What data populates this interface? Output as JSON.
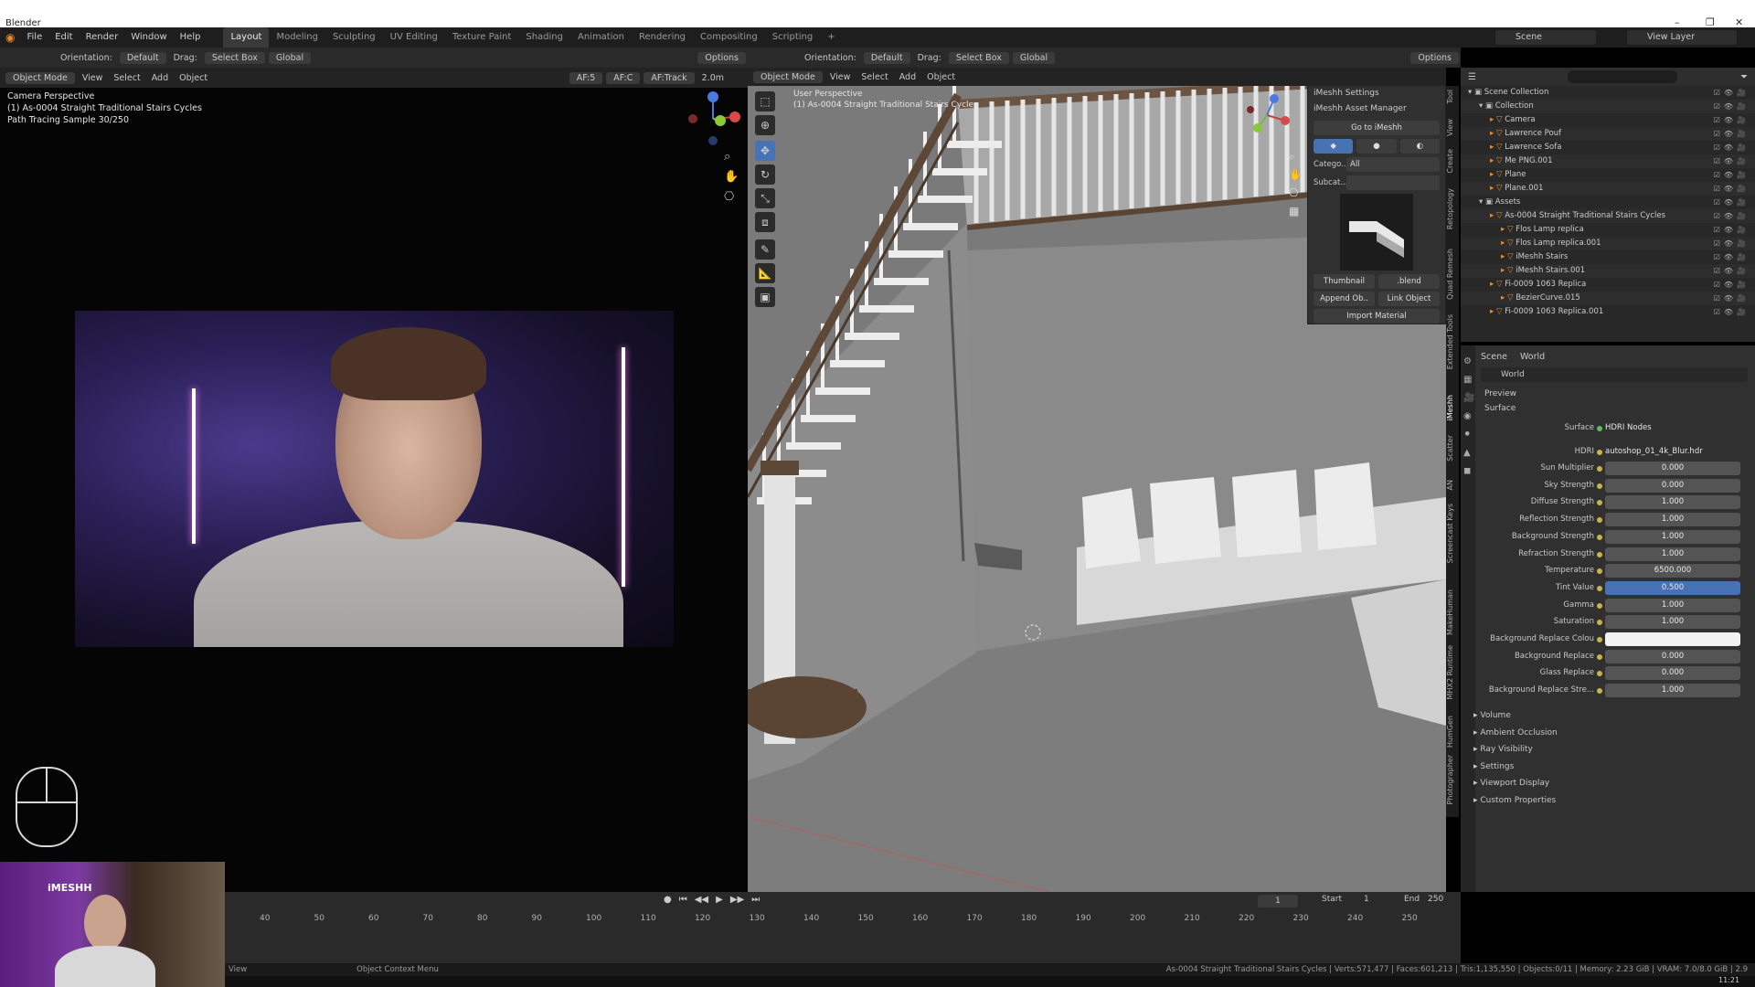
{
  "window": {
    "title": "Blender"
  },
  "menu": [
    "File",
    "Edit",
    "Render",
    "Window",
    "Help"
  ],
  "workspaces": [
    "Layout",
    "Modeling",
    "Sculpting",
    "UV Editing",
    "Texture Paint",
    "Shading",
    "Animation",
    "Rendering",
    "Compositing",
    "Scripting",
    "+"
  ],
  "active_workspace": "Layout",
  "scene_field": "Scene",
  "view_layer_field": "View Layer",
  "left_header": {
    "orientation_label": "Orientation:",
    "orientation_value": "Default",
    "drag_label": "Drag:",
    "drag_value": "Select Box",
    "transform": "Global",
    "options": "Options",
    "mode": "Object Mode",
    "view": "View",
    "select": "Select",
    "add": "Add",
    "object": "Object",
    "af5": "AF:5",
    "afc": "AF:C",
    "aftrack": "AF:Track",
    "dist": "2.0m"
  },
  "left_overlay": {
    "line1": "Camera Perspective",
    "line2": "(1) As-0004 Straight Traditional Stairs Cycles",
    "line3": "Path Tracing Sample 30/250"
  },
  "right_header": {
    "orientation_label": "Orientation:",
    "orientation_value": "Default",
    "drag_label": "Drag:",
    "drag_value": "Select Box",
    "transform": "Global",
    "options": "Options",
    "mode": "Object Mode",
    "view": "View",
    "select": "Select",
    "add": "Add",
    "object": "Object"
  },
  "right_overlay": {
    "line1": "User Perspective",
    "line2": "(1) As-0004 Straight Traditional Stairs Cycles"
  },
  "imeshh": {
    "settings": "iMeshh Settings",
    "asset_manager": "iMeshh Asset Manager",
    "goto": "Go to iMeshh",
    "category_label": "Catego...",
    "category_value": "All",
    "subcat_label": "Subcat...",
    "thumbnail": "Thumbnail",
    "blend": ".blend",
    "append": "Append Ob..",
    "link": "Link Object",
    "import_material": "Import Material"
  },
  "vtabs": [
    "Tool",
    "View",
    "Create",
    "Retopology",
    "Quad Remesh",
    "Extended Tools",
    "iMeshh",
    "Scatter",
    "AN",
    "Screencast Keys",
    "MakeHuman",
    "MHX2 Runtime",
    "HumGen",
    "Photographer"
  ],
  "outliner": [
    {
      "indent": 0,
      "name": "Scene Collection"
    },
    {
      "indent": 1,
      "name": "Collection"
    },
    {
      "indent": 2,
      "name": "Camera"
    },
    {
      "indent": 2,
      "name": "Lawrence Pouf"
    },
    {
      "indent": 2,
      "name": "Lawrence Sofa"
    },
    {
      "indent": 2,
      "name": "Me PNG.001"
    },
    {
      "indent": 2,
      "name": "Plane"
    },
    {
      "indent": 2,
      "name": "Plane.001"
    },
    {
      "indent": 1,
      "name": "Assets"
    },
    {
      "indent": 2,
      "name": "As-0004 Straight Traditional Stairs Cycles"
    },
    {
      "indent": 3,
      "name": "Flos Lamp replica"
    },
    {
      "indent": 3,
      "name": "Flos Lamp replica.001"
    },
    {
      "indent": 3,
      "name": "iMeshh Stairs"
    },
    {
      "indent": 3,
      "name": "iMeshh Stairs.001"
    },
    {
      "indent": 2,
      "name": "Fi-0009 1063 Replica"
    },
    {
      "indent": 3,
      "name": "BezierCurve.015"
    },
    {
      "indent": 2,
      "name": "Fi-0009 1063 Replica.001"
    }
  ],
  "props": {
    "tab_scene": "Scene",
    "tab_world": "World",
    "world_name": "World",
    "preview": "Preview",
    "surface": "Surface",
    "surface_label": "Surface",
    "surface_value": "HDRI Nodes",
    "hdri_label": "HDRI",
    "hdri_value": "autoshop_01_4k_Blur.hdr",
    "rows": [
      {
        "label": "Sun Multiplier",
        "value": "0.000"
      },
      {
        "label": "Sky Strength",
        "value": "0.000"
      },
      {
        "label": "Diffuse Strength",
        "value": "1.000"
      },
      {
        "label": "Reflection Strength",
        "value": "1.000"
      },
      {
        "label": "Background Strength",
        "value": "1.000"
      },
      {
        "label": "Refraction Strength",
        "value": "1.000"
      },
      {
        "label": "Temperature",
        "value": "6500.000"
      },
      {
        "label": "Tint Value",
        "value": "0.500"
      },
      {
        "label": "Gamma",
        "value": "1.000"
      },
      {
        "label": "Saturation",
        "value": "1.000"
      },
      {
        "label": "Background Replace Colou",
        "value": ""
      },
      {
        "label": "Background Replace",
        "value": "0.000"
      },
      {
        "label": "Glass Replace",
        "value": "0.000"
      },
      {
        "label": "Background Replace Stre...",
        "value": "1.000"
      }
    ],
    "sections": [
      "Volume",
      "Ambient Occlusion",
      "Ray Visibility",
      "Settings",
      "Viewport Display",
      "Custom Properties"
    ]
  },
  "timeline": {
    "current_frame": "1",
    "start_label": "Start",
    "start": "1",
    "end_label": "End",
    "end": "250",
    "ticks": [
      "40",
      "50",
      "60",
      "70",
      "80",
      "90",
      "100",
      "110",
      "120",
      "130",
      "140",
      "150",
      "160",
      "170",
      "180",
      "190",
      "200",
      "210",
      "220",
      "230",
      "240",
      "250"
    ]
  },
  "status": {
    "left": "View",
    "context": "Object Context Menu",
    "right": "As-0004 Straight Traditional Stairs Cycles | Verts:571,477 | Faces:601,213 | Tris:1,135,550 | Objects:0/11 | Memory: 2.23 GiB | VRAM: 7.0/8.0 GiB | 2.9"
  },
  "clock": "11:21",
  "webcam_logo": "iMESHH"
}
